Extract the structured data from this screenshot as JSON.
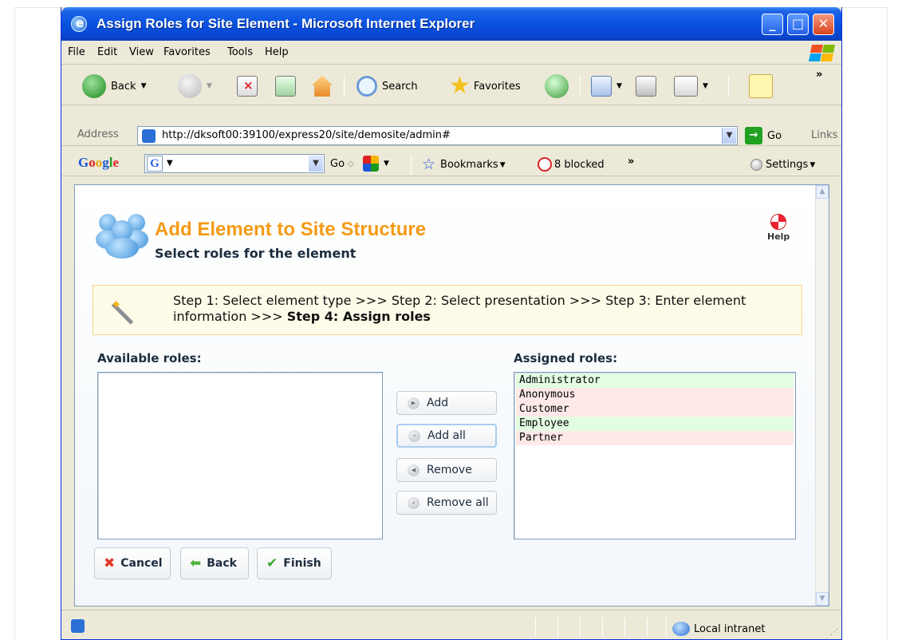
{
  "window": {
    "title": "Assign Roles for Site Element - Microsoft Internet Explorer"
  },
  "menu": [
    "File",
    "Edit",
    "View",
    "Favorites",
    "Tools",
    "Help"
  ],
  "toolbar": {
    "back": "Back",
    "search": "Search",
    "favorites": "Favorites"
  },
  "address": {
    "label": "Address",
    "url": "http://dksoft00:39100/express20/site/demosite/admin#",
    "go": "Go",
    "links": "Links"
  },
  "google": {
    "logo": "Google",
    "go": "Go",
    "bookmarks": "Bookmarks",
    "blocked": "8 blocked",
    "settings": "Settings"
  },
  "page": {
    "title": "Add Element to Site Structure",
    "subtitle": "Select roles for the element",
    "help": "Help",
    "steps_prefix": "Step 1: Select element type >>> Step 2: Select presentation >>> Step 3: Enter element information >>> ",
    "steps_current": "Step 4: Assign roles",
    "available_label": "Available roles:",
    "assigned_label": "Assigned roles:",
    "assigned_roles": [
      {
        "name": "Administrator",
        "status": "green"
      },
      {
        "name": "Anonymous",
        "status": "pink"
      },
      {
        "name": "Customer",
        "status": "pink"
      },
      {
        "name": "Employee",
        "status": "green"
      },
      {
        "name": "Partner",
        "status": "pink"
      }
    ],
    "buttons": {
      "add": "Add",
      "add_all": "Add all",
      "remove": "Remove",
      "remove_all": "Remove all",
      "cancel": "Cancel",
      "back": "Back",
      "finish": "Finish"
    }
  },
  "status": {
    "zone": "Local intranet"
  },
  "colors": {
    "title_orange": "#f59a16",
    "role_green": "#e3fde3",
    "role_pink": "#ffe8e8",
    "xp_blue": "#0a54e3"
  }
}
